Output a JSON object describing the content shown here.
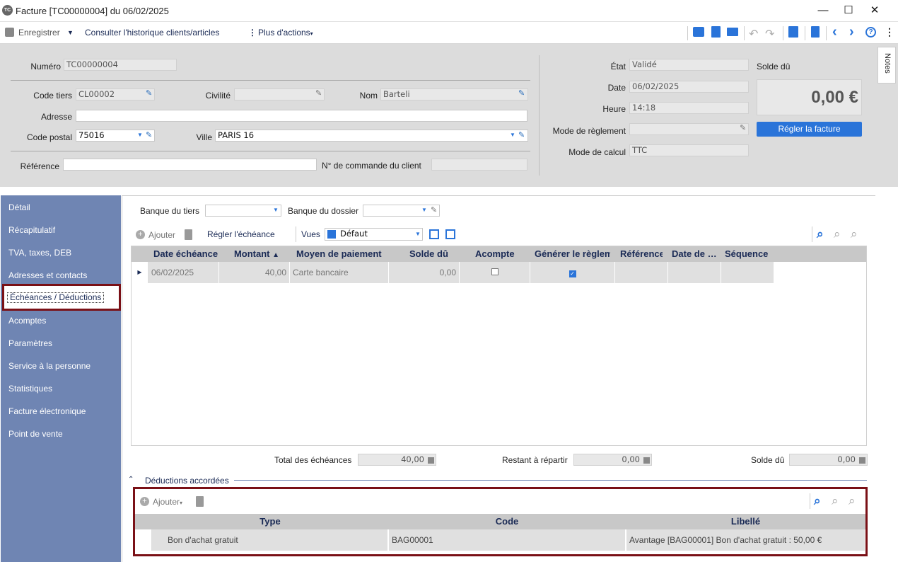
{
  "window": {
    "title": "Facture [TC00000004] du 06/02/2025",
    "logo_text": "TC"
  },
  "toolbar": {
    "save_label": "Enregistrer",
    "history_label": "Consulter l'historique clients/articles",
    "more_actions_label": "Plus d'actions"
  },
  "header": {
    "numero_label": "Numéro",
    "numero_value": "TC00000004",
    "code_tiers_label": "Code tiers",
    "code_tiers_value": "CL00002",
    "civilite_label": "Civilité",
    "civilite_value": "",
    "nom_label": "Nom",
    "nom_value": "Barteli",
    "adresse_label": "Adresse",
    "adresse_value": "",
    "code_postal_label": "Code postal",
    "code_postal_value": "75016",
    "ville_label": "Ville",
    "ville_value": "PARIS 16",
    "reference_label": "Référence",
    "reference_value": "",
    "commande_label": "N° de commande du client",
    "commande_value": "",
    "etat_label": "État",
    "etat_value": "Validé",
    "date_label": "Date",
    "date_value": "06/02/2025",
    "heure_label": "Heure",
    "heure_value": "14:18",
    "mode_reglement_label": "Mode de règlement",
    "mode_reglement_value": "",
    "mode_calcul_label": "Mode de calcul",
    "mode_calcul_value": "TTC",
    "solde_du_label": "Solde dû",
    "solde_du_value": "0,00 €",
    "regler_button": "Régler la facture"
  },
  "notes_tab": "Notes",
  "sidebar": {
    "items": [
      {
        "label": "Détail"
      },
      {
        "label": "Récapitulatif"
      },
      {
        "label": "TVA, taxes, DEB"
      },
      {
        "label": "Adresses et contacts"
      },
      {
        "label": "Échéances / Déductions"
      },
      {
        "label": "Acomptes"
      },
      {
        "label": "Paramètres"
      },
      {
        "label": "Service à la personne"
      },
      {
        "label": "Statistiques"
      },
      {
        "label": "Facture électronique"
      },
      {
        "label": "Point de vente"
      }
    ]
  },
  "main": {
    "banque_tiers_label": "Banque du tiers",
    "banque_dossier_label": "Banque du dossier",
    "ajouter_label": "Ajouter",
    "regler_echeance_label": "Régler l'échéance",
    "vues_label": "Vues",
    "vue_value": "Défaut",
    "columns": [
      "Date échéance",
      "Montant",
      "Moyen de paiement",
      "Solde dû",
      "Acompte",
      "Générer le règlement",
      "Référence",
      "Date de …",
      "Séquence"
    ],
    "rows": [
      {
        "date": "06/02/2025",
        "montant": "40,00",
        "moyen": "Carte bancaire",
        "solde": "0,00",
        "acompte": false,
        "generer": true,
        "reference": "",
        "date2": "",
        "sequence": ""
      }
    ],
    "total_label": "Total des échéances",
    "total_value": "40,00",
    "restant_label": "Restant à répartir",
    "restant_value": "0,00",
    "solde_label": "Solde dû",
    "solde_value": "0,00"
  },
  "deductions": {
    "section_label": "Déductions accordées",
    "ajouter_label": "Ajouter",
    "columns": [
      "Type",
      "Code",
      "Libellé"
    ],
    "rows": [
      {
        "type": "Bon d'achat gratuit",
        "code": "BAG00001",
        "libelle": "Avantage [BAG00001] Bon d'achat gratuit : 50,00 €"
      }
    ]
  },
  "colors": {
    "accent": "#2a74d9",
    "sidebar": "#6f85b3",
    "highlight_border": "#7a1016"
  }
}
